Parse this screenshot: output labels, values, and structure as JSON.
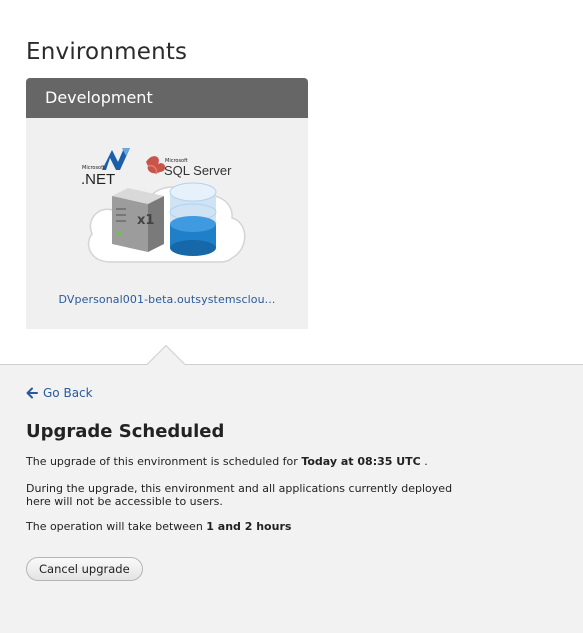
{
  "page": {
    "title": "Environments"
  },
  "environment": {
    "name": "Development",
    "url": "DVpersonal001-beta.outsystemsclou...",
    "stack": {
      "dotnet_logo": {
        "small": "Microsoft",
        "large": ".NET"
      },
      "sql_logo": {
        "small": "Microsoft",
        "large": "SQL Server"
      },
      "server_count": "x1"
    }
  },
  "detail": {
    "go_back": "Go Back",
    "title": "Upgrade Scheduled",
    "scheduled_prefix": "The upgrade of this environment is scheduled for ",
    "scheduled_time": "Today at 08:35 UTC",
    "scheduled_suffix": " .",
    "warning_line1": "During the upgrade, this environment and all applications currently deployed",
    "warning_line2": "here will not be accessible to users.",
    "duration_prefix": "The operation will take between ",
    "duration_value": "1 and 2 hours",
    "cancel_label": "Cancel upgrade"
  },
  "colors": {
    "header_bg": "#666666",
    "card_bg": "#f0f0f0",
    "panel_bg": "#f2f2f2",
    "link": "#2a5a99",
    "database_blue": "#1f7fc8",
    "sql_red": "#c0392b"
  },
  "icons": [
    "dotnet-logo-icon",
    "sql-server-logo-icon",
    "cloud-icon",
    "server-icon",
    "database-icon",
    "back-arrow-icon"
  ]
}
